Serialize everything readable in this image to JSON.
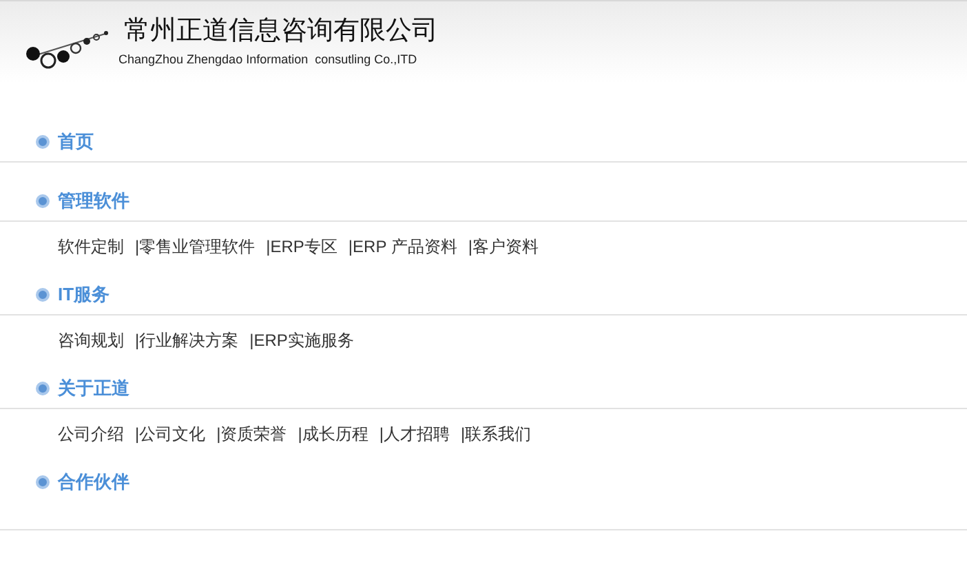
{
  "header": {
    "title": "常州正道信息咨询有限公司",
    "subtitle": "ChangZhou Zhengdao Information  consutling Co.,ITD"
  },
  "sections": [
    {
      "title": "首页"
    },
    {
      "title": "管理软件",
      "links": [
        "软件定制",
        "|零售业管理软件",
        "|ERP专区",
        "|ERP 产品资料",
        "|客户资料"
      ]
    },
    {
      "title": "IT服务",
      "links": [
        "咨询规划",
        "|行业解决方案",
        "|ERP实施服务"
      ]
    },
    {
      "title": "关于正道",
      "links": [
        "公司介绍",
        "|公司文化",
        "|资质荣誉",
        "|成长历程",
        "|人才招聘",
        "|联系我们"
      ]
    },
    {
      "title": "合作伙伴"
    }
  ]
}
